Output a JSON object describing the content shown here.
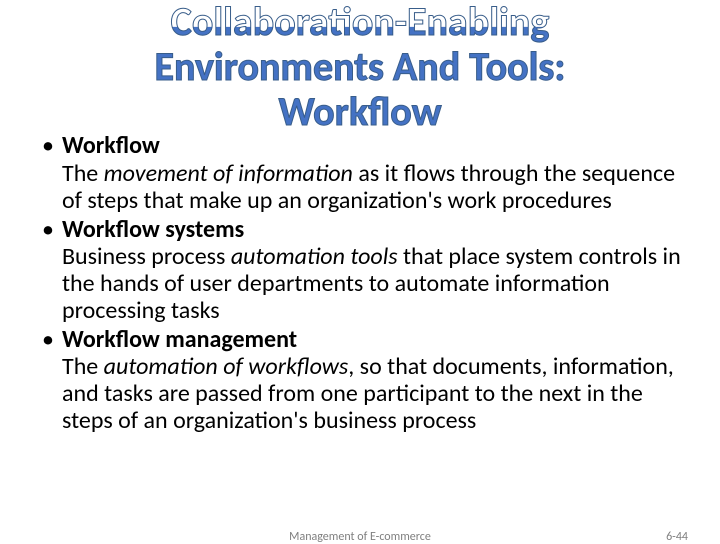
{
  "title": "Collaboration-Enabling\nEnvironments And Tools:\nWorkflow",
  "bullets": [
    {
      "term": "Workflow",
      "def_pre": "The ",
      "def_ital": "movement of information",
      "def_post": " as it flows through the sequence of steps that make up an organization's work procedures"
    },
    {
      "term": "Workflow systems",
      "def_pre": "Business process ",
      "def_ital": "automation tools",
      "def_post": " that place system controls in the hands of user departments to automate information processing tasks"
    },
    {
      "term": "Workflow management",
      "def_pre": "The ",
      "def_ital": "automation of workflows",
      "def_post": ", so that documents, information, and tasks are passed from one participant to the next in the steps of an organization's business process"
    }
  ],
  "footer": {
    "center": "Management of E-commerce",
    "right": "6-44"
  }
}
